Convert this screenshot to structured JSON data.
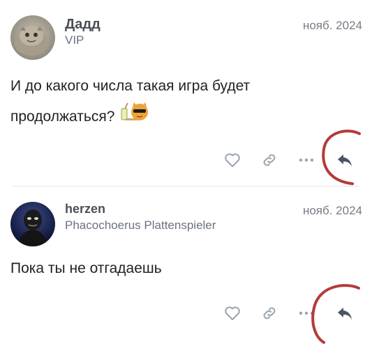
{
  "posts": [
    {
      "username": "Дадд",
      "user_title": "VIP",
      "date": "нояб. 2024",
      "body_lines": [
        "И до какого числа такая игра будет",
        "продолжаться?"
      ],
      "avatar_icon": "manul-cat-avatar",
      "emoji_icon": "cool-cat-with-drink-emoji"
    },
    {
      "username": "herzen",
      "user_title": "Phacochoerus Plattenspieler",
      "date": "нояб. 2024",
      "body_lines": [
        "Пока ты не отгадаешь"
      ],
      "avatar_icon": "dark-figure-avatar"
    }
  ],
  "actions": [
    "like-button",
    "copy-link-button",
    "more-button",
    "reply-button"
  ],
  "colors": {
    "icon_gray": "#9aa3ad",
    "reply_icon": "#4b5563",
    "annotation_red": "#b33b3b",
    "username": "#4a4f59",
    "muted": "#767b84"
  }
}
